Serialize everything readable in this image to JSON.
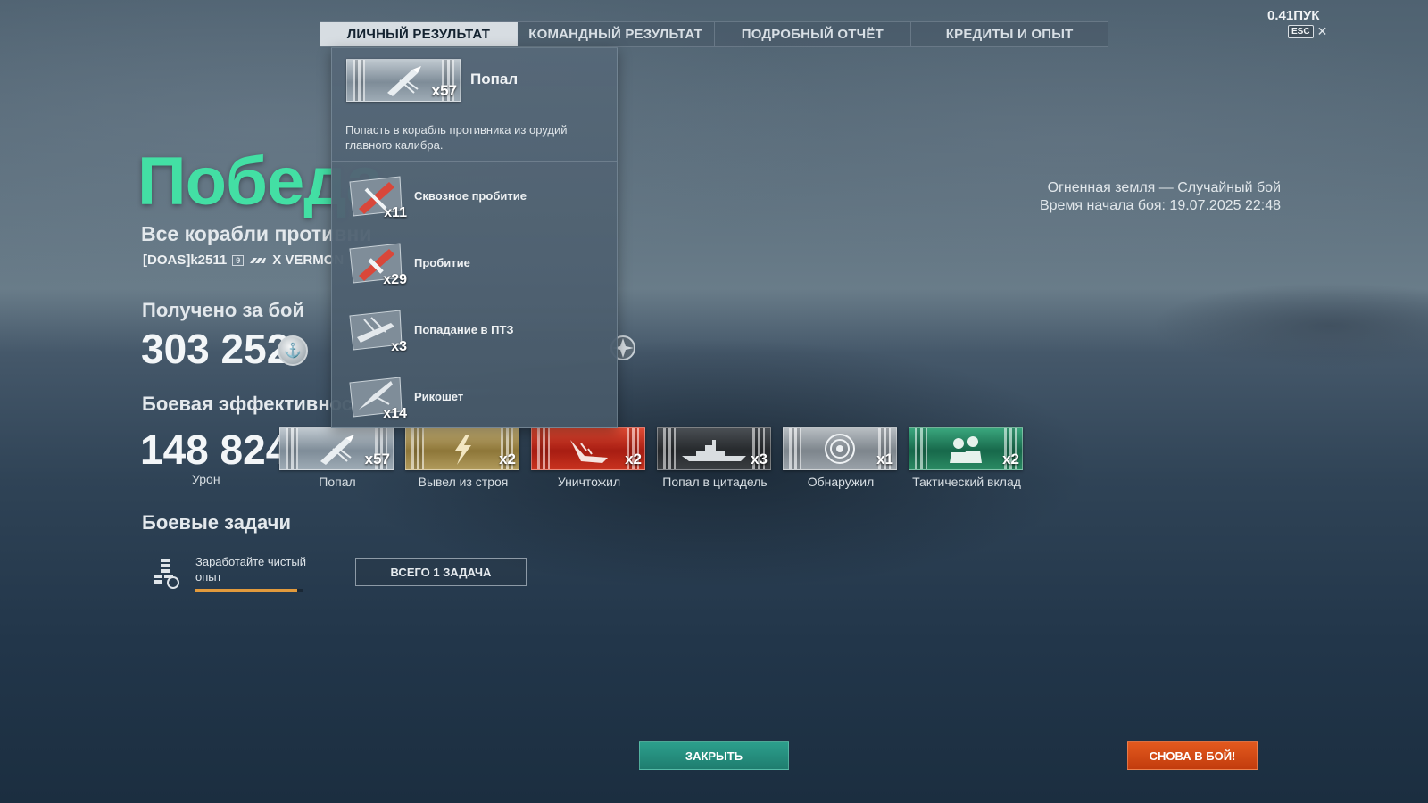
{
  "tabs": [
    {
      "label": "ЛИЧНЫЙ РЕЗУЛЬТАТ",
      "active": true
    },
    {
      "label": "КОМАНДНЫЙ РЕЗУЛЬТАТ",
      "active": false
    },
    {
      "label": "ПОДРОБНЫЙ ОТЧЁТ",
      "active": false
    },
    {
      "label": "КРЕДИТЫ И ОПЫТ",
      "active": false
    }
  ],
  "top_right": {
    "ping": "0.41ПУК",
    "esc_key": "ESC",
    "close_glyph": "✕"
  },
  "result": {
    "title": "Победа",
    "subtitle": "Все корабли противни",
    "player_name": "[DOAS]k2511",
    "tier_badge": "9",
    "ship_name": "X VERMON"
  },
  "battle_info": {
    "map_mode": "Огненная земля — Случайный бой",
    "start_time": "Время начала боя: 19.07.2025 22:48"
  },
  "earned": {
    "title": "Получено за бой",
    "value": "303 252",
    "coin_icon": "silver-coin-icon"
  },
  "efficiency": {
    "title": "Боевая эффективнос",
    "damage_value": "148 824",
    "damage_label": "Урон",
    "ribbons": [
      {
        "label": "Попал",
        "count": "x57",
        "style": "silver",
        "icon": "shell-hit-icon"
      },
      {
        "label": "Вывел из строя",
        "count": "x2",
        "style": "gold",
        "icon": "incapacitate-icon"
      },
      {
        "label": "Уничтожил",
        "count": "x2",
        "style": "red",
        "icon": "destroyed-ship-icon"
      },
      {
        "label": "Попал в цитадель",
        "count": "x3",
        "style": "dark",
        "icon": "citadel-ship-icon"
      },
      {
        "label": "Обнаружил",
        "count": "x1",
        "style": "grey",
        "icon": "spotted-radar-icon"
      },
      {
        "label": "Тактический вклад",
        "count": "x2",
        "style": "green",
        "icon": "tactical-sailors-icon"
      }
    ]
  },
  "missions": {
    "title": "Боевые задачи",
    "item_text": "Заработайте чистый опыт",
    "progress": 0.95,
    "all_tasks_button": "ВСЕГО 1 ЗАДАЧА"
  },
  "popup": {
    "head_count": "x57",
    "head_title": "Попал",
    "description": "Попасть в корабль противника из орудий главного калибра.",
    "items": [
      {
        "label": "Сквозное пробитие",
        "count": "x11",
        "icon": "overpenetration-icon",
        "style": "red"
      },
      {
        "label": "Пробитие",
        "count": "x29",
        "icon": "penetration-icon",
        "style": "red"
      },
      {
        "label": "Попадание в ПТЗ",
        "count": "x3",
        "icon": "torpedo-belt-hit-icon",
        "style": "silver"
      },
      {
        "label": "Рикошет",
        "count": "x14",
        "icon": "ricochet-icon",
        "style": "silver"
      }
    ]
  },
  "buttons": {
    "close": "ЗАКРЫТЬ",
    "battle_again": "СНОВА В БОЙ!"
  },
  "colors": {
    "victory": "#43dfa4",
    "close_button": "#2c9f8c",
    "battle_button": "#e3591e",
    "mission_progress": "#e29a3c"
  }
}
